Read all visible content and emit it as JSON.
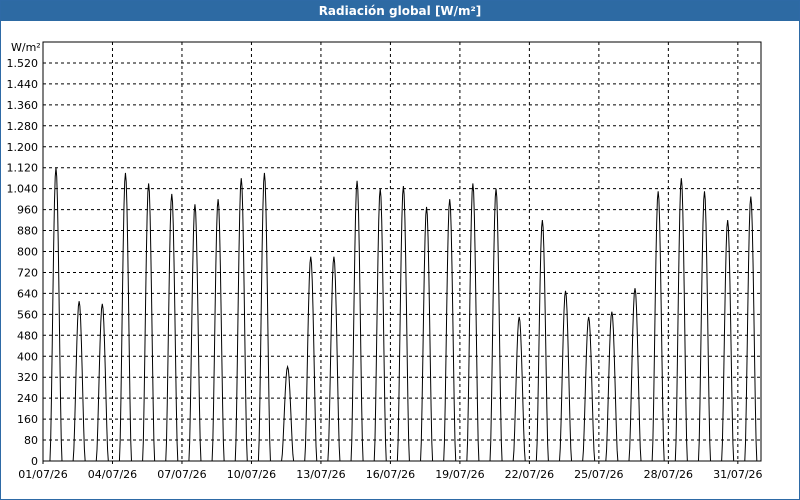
{
  "window": {
    "title": "Radiación global [W/m²]"
  },
  "chart_data": {
    "type": "line",
    "title": "Radiación global [W/m²]",
    "ylabel": "W/m²",
    "xlabel": "",
    "ylim": [
      0,
      1600
    ],
    "grid": true,
    "legend": "none",
    "y_ticks": [
      "1.520",
      "1.440",
      "1.360",
      "1.280",
      "1.200",
      "1.120",
      "1.040",
      "960",
      "880",
      "800",
      "720",
      "640",
      "560",
      "480",
      "400",
      "320",
      "240",
      "160",
      "80",
      "0"
    ],
    "x_ticks": [
      "01/07/26",
      "04/07/26",
      "07/07/26",
      "10/07/26",
      "13/07/26",
      "16/07/26",
      "19/07/26",
      "22/07/26",
      "25/07/26",
      "28/07/26",
      "31/07/26"
    ],
    "series": [
      {
        "color": "#000000",
        "daily_peaks": [
          {
            "date": "01/07/26",
            "peak": 1120
          },
          {
            "date": "02/07/26",
            "peak": 610
          },
          {
            "date": "03/07/26",
            "peak": 600
          },
          {
            "date": "04/07/26",
            "peak": 1100
          },
          {
            "date": "05/07/26",
            "peak": 1060
          },
          {
            "date": "06/07/26",
            "peak": 1020
          },
          {
            "date": "07/07/26",
            "peak": 980
          },
          {
            "date": "08/07/26",
            "peak": 1000
          },
          {
            "date": "09/07/26",
            "peak": 1080
          },
          {
            "date": "10/07/26",
            "peak": 1100
          },
          {
            "date": "11/07/26",
            "peak": 360
          },
          {
            "date": "12/07/26",
            "peak": 780
          },
          {
            "date": "13/07/26",
            "peak": 780
          },
          {
            "date": "14/07/26",
            "peak": 1070
          },
          {
            "date": "15/07/26",
            "peak": 1040
          },
          {
            "date": "16/07/26",
            "peak": 1050
          },
          {
            "date": "17/07/26",
            "peak": 970
          },
          {
            "date": "18/07/26",
            "peak": 1000
          },
          {
            "date": "19/07/26",
            "peak": 1060
          },
          {
            "date": "20/07/26",
            "peak": 1040
          },
          {
            "date": "21/07/26",
            "peak": 550
          },
          {
            "date": "22/07/26",
            "peak": 920
          },
          {
            "date": "23/07/26",
            "peak": 650
          },
          {
            "date": "24/07/26",
            "peak": 550
          },
          {
            "date": "25/07/26",
            "peak": 570
          },
          {
            "date": "26/07/26",
            "peak": 660
          },
          {
            "date": "27/07/26",
            "peak": 1030
          },
          {
            "date": "28/07/26",
            "peak": 1080
          },
          {
            "date": "29/07/26",
            "peak": 1030
          },
          {
            "date": "30/07/26",
            "peak": 920
          },
          {
            "date": "31/07/26",
            "peak": 1010
          }
        ]
      }
    ]
  }
}
